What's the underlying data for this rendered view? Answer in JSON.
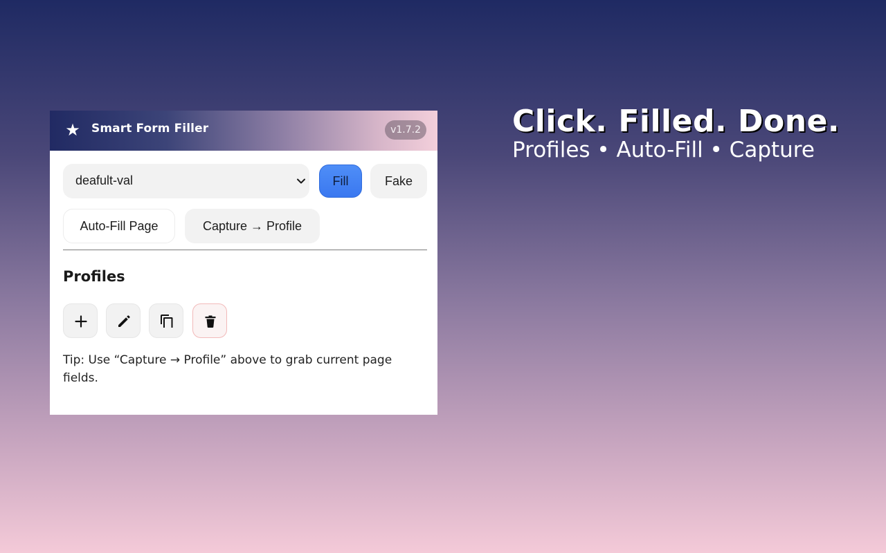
{
  "popup": {
    "header": {
      "title": "Smart Form Filler",
      "version": "v1.7.2",
      "logo_icon": "star-icon"
    },
    "profile_select": {
      "selected_value": "deafult-val",
      "icon": "chevron-down-icon"
    },
    "actions": {
      "fill_label": "Fill",
      "fake_label": "Fake",
      "autofill_label": "Auto-Fill Page",
      "capture_label": "Capture → Profile"
    },
    "profiles": {
      "title": "Profiles",
      "buttons": [
        {
          "icon": "plus-icon"
        },
        {
          "icon": "pencil-icon"
        },
        {
          "icon": "copy-icon"
        },
        {
          "icon": "trash-icon"
        }
      ],
      "tip": "Tip: Use “Capture → Profile” above to grab current page fields."
    }
  },
  "promo": {
    "headline": "Click. Filled. Done.",
    "subheadline": "Profiles • Auto-Fill • Capture"
  },
  "colors": {
    "accent": "#3a78f0",
    "danger_border": "#f2b9b9",
    "background_top": "#1f2a63",
    "background_bottom": "#f4cad8"
  }
}
